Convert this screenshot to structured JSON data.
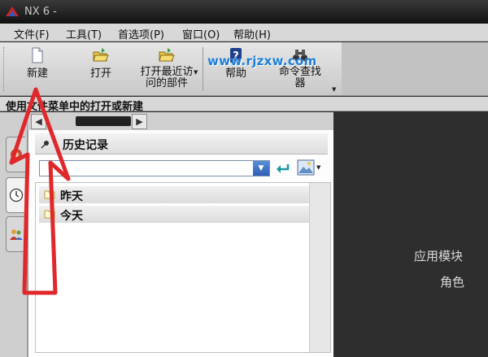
{
  "window": {
    "title": "NX 6 -"
  },
  "menu": [
    {
      "label": "文件(F)"
    },
    {
      "label": "工具(T)"
    },
    {
      "label": "首选项(P)"
    },
    {
      "label": "窗口(O)"
    },
    {
      "label": "帮助(H)"
    }
  ],
  "toolbar": {
    "new": {
      "label": "新建",
      "icon": "new-file-icon"
    },
    "open": {
      "label": "打开",
      "icon": "open-folder-icon"
    },
    "recent": {
      "label_line1": "打开最近访",
      "label_line2": "问的部件",
      "icon": "open-recent-icon"
    },
    "help": {
      "label": "帮助",
      "icon": "help-icon"
    },
    "command_finder": {
      "label_line1": "命令查找",
      "label_line2": "器",
      "icon": "binoculars-icon"
    }
  },
  "watermark": "www.rjzxw.com",
  "statusbar": {
    "text": "使用文件菜单中的打开或新建"
  },
  "history_panel": {
    "title": "历史记录",
    "search_value": "",
    "items": [
      {
        "label": "昨天"
      },
      {
        "label": "今天"
      }
    ]
  },
  "right_panel": {
    "line1": "应用模块",
    "line2": "角色"
  },
  "colors": {
    "annotation_red": "#e0282b",
    "accent_blue": "#2c5fb4",
    "watermark_blue": "#1e7fd8"
  }
}
